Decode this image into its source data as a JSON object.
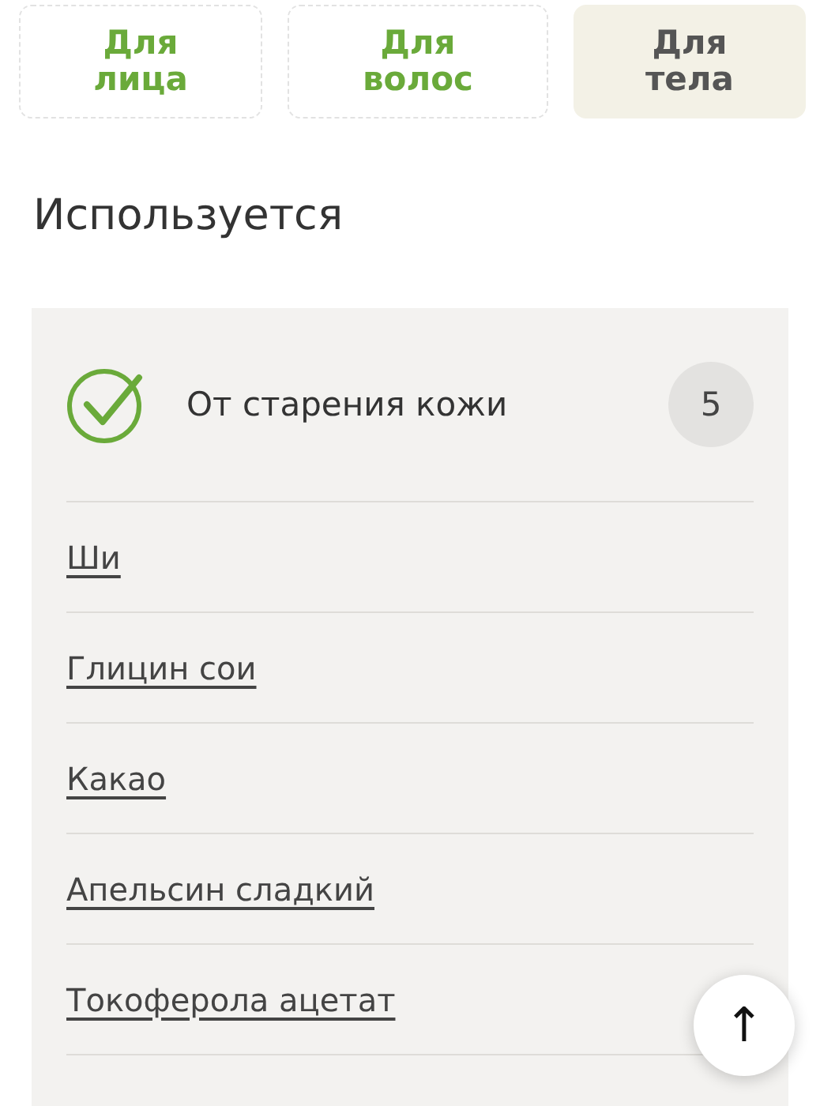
{
  "tabs": [
    {
      "label": "Для лица",
      "selected": false
    },
    {
      "label": "Для волос",
      "selected": false
    },
    {
      "label": "Для тела",
      "selected": true
    }
  ],
  "section_title": "Используется",
  "group": {
    "title": "От старения кожи",
    "count": "5",
    "checked": true,
    "items": [
      "Ши",
      "Глицин сои",
      "Какао",
      "Апельсин сладкий",
      "Токоферола ацетат"
    ]
  },
  "scroll_top_button": {
    "label": "↑"
  }
}
